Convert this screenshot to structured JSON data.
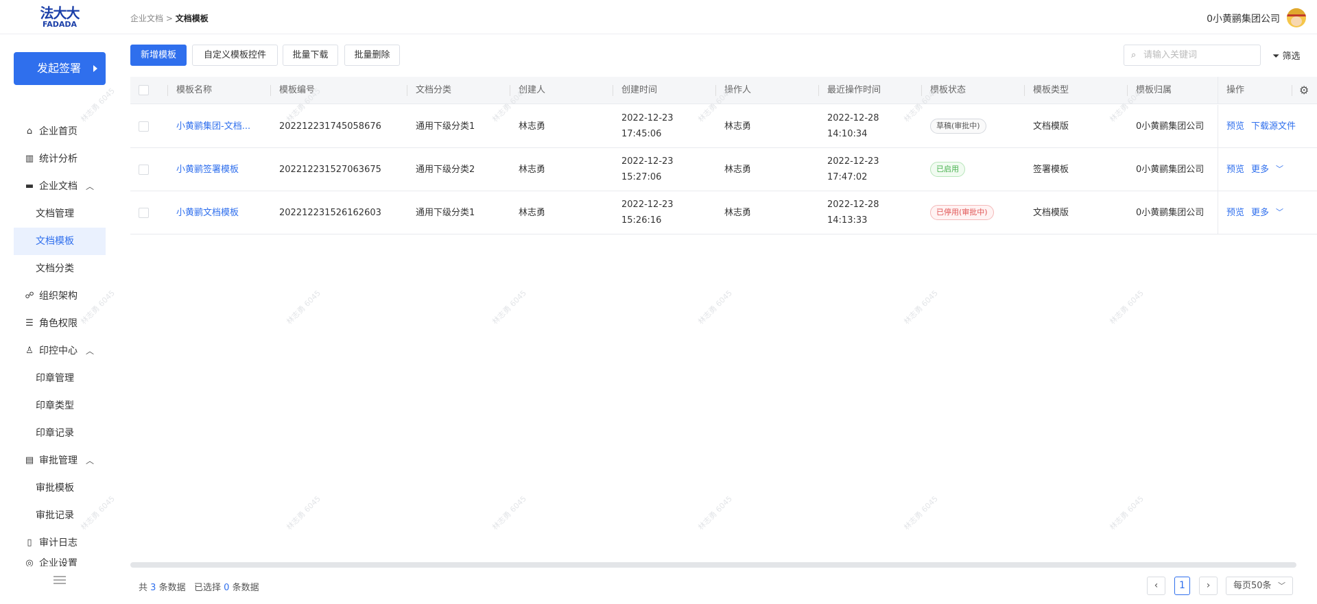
{
  "app": {
    "logo_cn": "法大大",
    "logo_en": "FADADA"
  },
  "breadcrumb": {
    "parent": "企业文档",
    "sep": ">",
    "current": "文档模板"
  },
  "header": {
    "company": "0小黄鹂集团公司"
  },
  "sidebar": {
    "start_button": "发起签署",
    "items": [
      {
        "label": "企业首页",
        "icon": "home-icon"
      },
      {
        "label": "统计分析",
        "icon": "chart-icon"
      },
      {
        "label": "企业文档",
        "icon": "folder-icon",
        "expanded": true
      },
      {
        "label": "文档管理"
      },
      {
        "label": "文档模板",
        "active": true
      },
      {
        "label": "文档分类"
      },
      {
        "label": "组织架构",
        "icon": "org-icon"
      },
      {
        "label": "角色权限",
        "icon": "role-icon"
      },
      {
        "label": "印控中心",
        "icon": "stamp-icon",
        "expanded": true
      },
      {
        "label": "印章管理"
      },
      {
        "label": "印章类型"
      },
      {
        "label": "印章记录"
      },
      {
        "label": "审批管理",
        "icon": "clipboard-icon",
        "expanded": true
      },
      {
        "label": "审批模板"
      },
      {
        "label": "审批记录"
      },
      {
        "label": "审计日志",
        "icon": "book-icon"
      },
      {
        "label": "企业设置",
        "icon": "settings-icon"
      }
    ]
  },
  "toolbar": {
    "add": "新增模板",
    "custom": "自定义模板控件",
    "download": "批量下载",
    "delete": "批量删除",
    "search_placeholder": "请输入关键词",
    "filter": "筛选"
  },
  "table": {
    "headers": [
      "模板名称",
      "模板编号",
      "文档分类",
      "创建人",
      "创建时间",
      "操作人",
      "最近操作时间",
      "模板状态",
      "模板类型",
      "模板归属",
      "操作"
    ],
    "rows": [
      {
        "name": "小黄鹂集团-文档...",
        "code": "202212231745058676",
        "category": "通用下级分类1",
        "creator": "林志勇",
        "created_date": "2022-12-23",
        "created_time": "17:45:06",
        "operator": "林志勇",
        "op_date": "2022-12-28",
        "op_time": "14:10:34",
        "status": "草稿(审批中)",
        "status_color": "gray",
        "type": "文档模版",
        "owner": "0小黄鹂集团公司",
        "action1": "预览",
        "action2": "下载源文件"
      },
      {
        "name": "小黄鹂签署模板",
        "code": "202212231527063675",
        "category": "通用下级分类2",
        "creator": "林志勇",
        "created_date": "2022-12-23",
        "created_time": "15:27:06",
        "operator": "林志勇",
        "op_date": "2022-12-23",
        "op_time": "17:47:02",
        "status": "已启用",
        "status_color": "green",
        "type": "签署模板",
        "owner": "0小黄鹂集团公司",
        "action1": "预览",
        "action2": "更多"
      },
      {
        "name": "小黄鹂文档模板",
        "code": "202212231526162603",
        "category": "通用下级分类1",
        "creator": "林志勇",
        "created_date": "2022-12-23",
        "created_time": "15:26:16",
        "operator": "林志勇",
        "op_date": "2022-12-28",
        "op_time": "14:13:33",
        "status": "已停用(审批中)",
        "status_color": "red",
        "type": "文档模版",
        "owner": "0小黄鹂集团公司",
        "action1": "预览",
        "action2": "更多"
      }
    ]
  },
  "footer": {
    "total_prefix": "共",
    "total": "3",
    "total_suffix": "条数据",
    "selected_prefix": "已选择",
    "selected": "0",
    "selected_suffix": "条数据",
    "page": "1",
    "page_size": "每页50条"
  },
  "watermark": "林志勇 6045"
}
